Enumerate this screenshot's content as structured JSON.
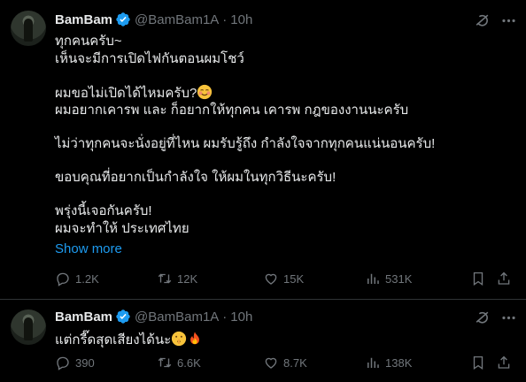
{
  "tweets": [
    {
      "author": "BamBam",
      "handle": "@BamBam1A",
      "time": "10h",
      "lines": [
        "ทุกคนครับ~",
        "เห็นจะมีการเปิดไฟกันตอนผมโชว์",
        "",
        "ผมขอไม่เปิดได้ไหมครับ?",
        "ผมอยากเคารพ และ ก็อยากให้ทุกคน เคารพ กฎของงานนะครับ",
        "",
        "ไม่ว่าทุกคนจะนั่งอยู่ที่ไหน ผมรับรู้ถึง กำลังใจจากทุกคนแน่นอนครับ!",
        "",
        "ขอบคุณที่อยากเป็นกำลังใจ ให้ผมในทุกวิธีนะครับ!",
        "",
        "พรุ่งนี้เจอกันครับ!",
        "ผมจะทำให้ ประเทศไทย"
      ],
      "show_more": "Show more",
      "stats": {
        "replies": "1.2K",
        "reposts": "12K",
        "likes": "15K",
        "views": "531K"
      }
    },
    {
      "author": "BamBam",
      "handle": "@BamBam1A",
      "time": "10h",
      "lines": [
        "แต่กรี๊ดสุดเสียงได้นะ"
      ],
      "stats": {
        "replies": "390",
        "reposts": "6.6K",
        "likes": "8.7K",
        "views": "138K"
      }
    }
  ],
  "icons": {
    "verified": "verified-badge-icon",
    "grok": "grok-icon",
    "more": "more-options-icon",
    "reply": "reply-icon",
    "repost": "repost-icon",
    "like": "like-icon",
    "views": "views-icon",
    "bookmark": "bookmark-icon",
    "share": "share-icon",
    "smile_emoji": "smiling-blushing-face-emoji",
    "shush_emoji": "shushing-face-emoji",
    "fire_emoji": "fire-emoji"
  },
  "colors": {
    "background": "#000000",
    "text": "#e7e9ea",
    "muted": "#71767b",
    "accent": "#1d9bf0",
    "divider": "#2f3336"
  }
}
